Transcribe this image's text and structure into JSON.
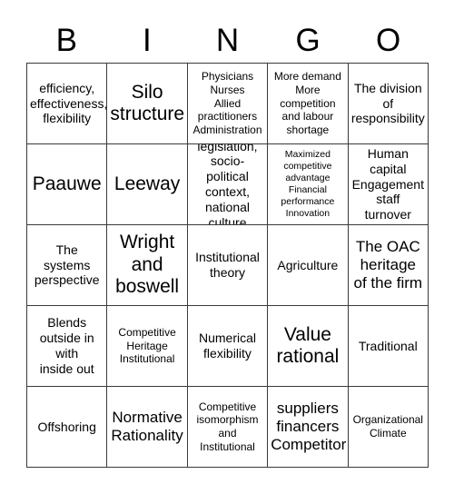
{
  "header": {
    "letters": [
      "B",
      "I",
      "N",
      "G",
      "O"
    ]
  },
  "grid": {
    "rows": 5,
    "columns": 5,
    "border_color": "#3a3a3a",
    "background_color": "#ffffff",
    "text_color": "#000000",
    "cells": [
      {
        "text": "efficiency,\neffectiveness,\nflexibility",
        "size": "md"
      },
      {
        "text": "Silo\nstructure",
        "size": "xl"
      },
      {
        "text": "Physicians\nNurses\nAllied\npractitioners\nAdministration",
        "size": "sm"
      },
      {
        "text": "More demand\nMore\ncompetition\nand labour\nshortage",
        "size": "sm"
      },
      {
        "text": "The division\nof\nresponsibility",
        "size": "md"
      },
      {
        "text": "Paauwe",
        "size": "xl"
      },
      {
        "text": "Leeway",
        "size": "xl"
      },
      {
        "text": "legislation,\nsocio-political\ncontext,\nnational\nculture",
        "size": "md"
      },
      {
        "text": "Maximized\ncompetitive\nadvantage\nFinancial\nperformance\nInnovation",
        "size": "xs"
      },
      {
        "text": "Human\ncapital\nEngagement\nstaff turnover",
        "size": "md"
      },
      {
        "text": "The\nsystems\nperspective",
        "size": "md"
      },
      {
        "text": "Wright\nand\nboswell",
        "size": "xl"
      },
      {
        "text": "Institutional\ntheory",
        "size": "md"
      },
      {
        "text": "Agriculture",
        "size": "md"
      },
      {
        "text": "The OAC\nheritage\nof the firm",
        "size": "lg"
      },
      {
        "text": "Blends\noutside in\nwith\ninside out",
        "size": "md"
      },
      {
        "text": "Competitive\nHeritage\nInstitutional",
        "size": "sm"
      },
      {
        "text": "Numerical\nflexibility",
        "size": "md"
      },
      {
        "text": "Value\nrational",
        "size": "xl"
      },
      {
        "text": "Traditional",
        "size": "md"
      },
      {
        "text": "Offshoring",
        "size": "md"
      },
      {
        "text": "Normative\nRationality",
        "size": "lg"
      },
      {
        "text": "Competitive\nisomorphism\nand\nInstitutional",
        "size": "sm"
      },
      {
        "text": "suppliers\nfinancers\nCompetitor",
        "size": "lg"
      },
      {
        "text": "Organizational\nClimate",
        "size": "sm"
      }
    ]
  }
}
